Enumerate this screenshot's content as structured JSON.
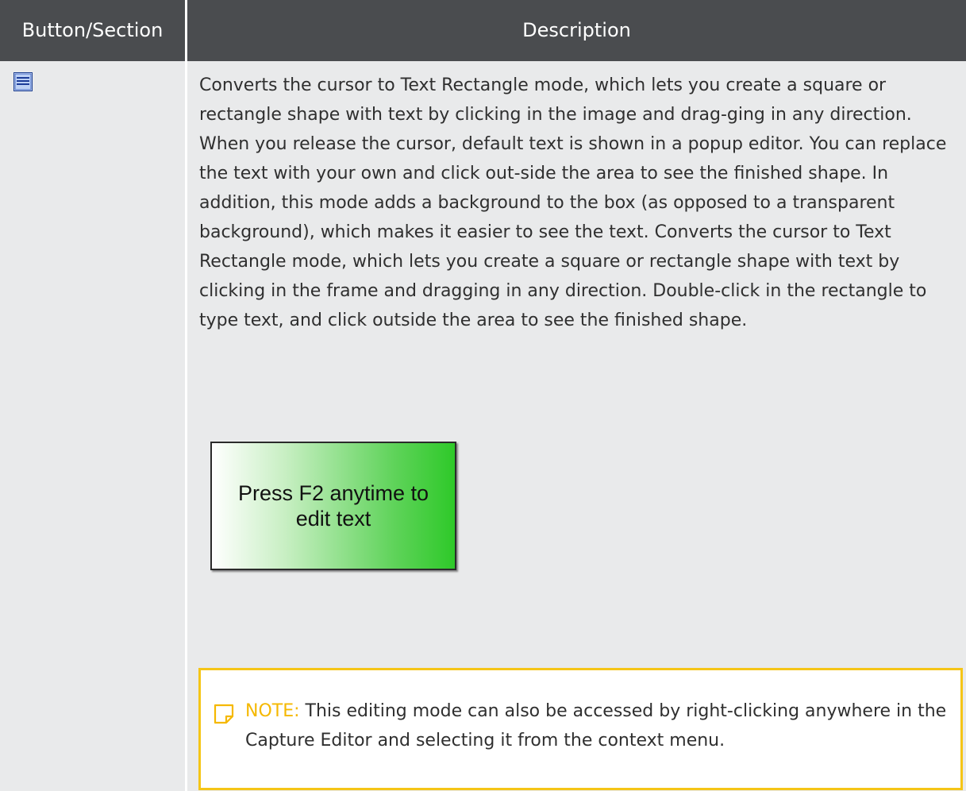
{
  "table": {
    "headers": {
      "col1": "Button/Section",
      "col2": "Description"
    },
    "rows": [
      {
        "icon": "text-rectangle-icon",
        "description": "Converts the cursor to Text Rectangle mode, which lets you create a square or rectangle shape with text by clicking in the image and drag-ging in any direction. When you release the cursor, default text is shown in a popup editor. You can replace the text with your own and click out-side the area to see the finished shape. In addition, this mode adds a background to the box (as opposed to a transparent background), which makes it easier to see the text. Converts the cursor to Text Rectangle mode, which lets you create a square or rectangle shape with text by clicking in the frame and dragging in any direction. Double-click in the rectangle to type text, and click outside the area to see the finished shape.",
        "example": {
          "line1": "Press F2 anytime to",
          "line2": "edit text"
        },
        "note": {
          "label": "NOTE:",
          "text": " This editing mode can also be accessed by right-clicking anywhere in the Capture Editor and selecting it from the context menu."
        }
      }
    ]
  },
  "colors": {
    "header_bg": "#4a4c4f",
    "row_bg": "#e9eaeb",
    "note_border": "#f5c517",
    "note_label": "#f5b800",
    "gradient_end": "#2ec929"
  }
}
